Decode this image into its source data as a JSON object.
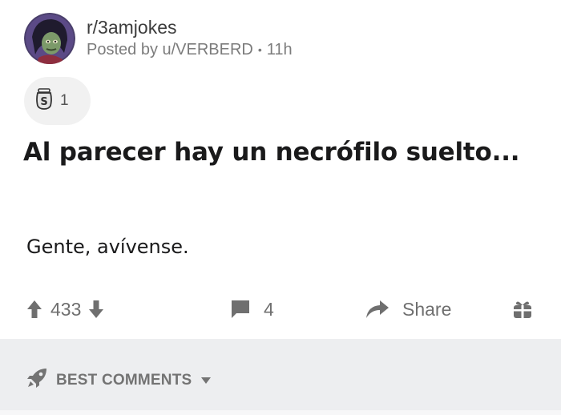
{
  "post": {
    "subreddit": "r/3amjokes",
    "posted_by": "Posted by u/VERBERD",
    "separator": "•",
    "time": "11h",
    "award_count": "1",
    "title": "Al parecer hay un necrófilo suelto...",
    "body": "Gente, avívense."
  },
  "actions": {
    "score": "433",
    "comment_count": "4",
    "share_label": "Share"
  },
  "sort": {
    "label": "BEST COMMENTS"
  },
  "icons": {
    "avatar": "avatar",
    "award": "silver-award-icon",
    "upvote": "upvote-arrow-icon",
    "downvote": "downvote-arrow-icon",
    "comment": "comment-icon",
    "share": "share-arrow-icon",
    "gift": "gift-icon",
    "sort": "rocket-icon",
    "caret": "chevron-down-icon"
  },
  "colors": {
    "muted": "#6f6f6f",
    "sort_bar": "#edeef0"
  }
}
